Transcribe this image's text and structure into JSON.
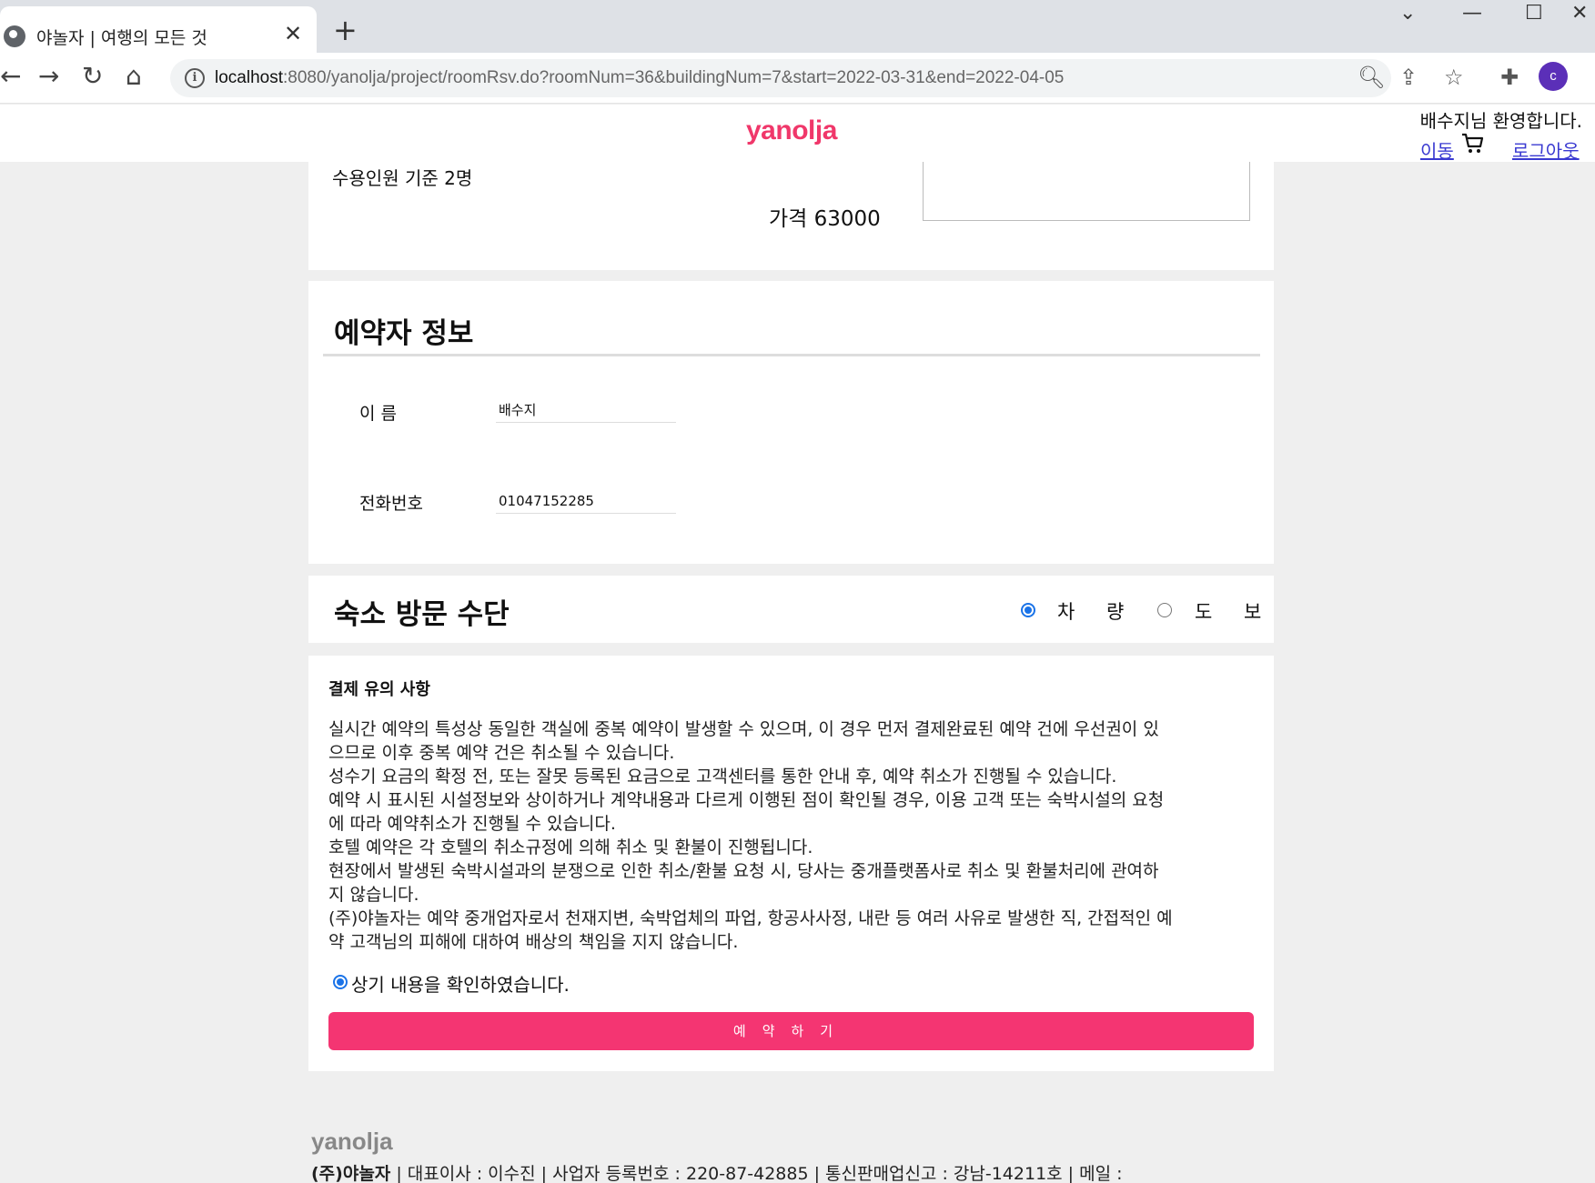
{
  "browser": {
    "tab_title": "야놀자 | 여행의 모든 것",
    "url_host": "localhost",
    "url_rest": ":8080/yanolja/project/roomRsv.do?roomNum=36&buildingNum=7&start=2022-03-31&end=2022-04-05",
    "profile_initial": "c"
  },
  "header": {
    "logo": "yanolja",
    "welcome": "배수지님 환영합니다.",
    "move_link": "이동",
    "logout_link": "로그아웃"
  },
  "room": {
    "capacity": "수용인원 기준 2명",
    "price": "가격 63000"
  },
  "booker": {
    "title": "예약자 정보",
    "name_label": "이 름",
    "name_value": "배수지",
    "phone_label": "전화번호",
    "phone_value": "01047152285"
  },
  "visit": {
    "title": "숙소 방문 수단",
    "option_car": "차 량",
    "option_walk": "도 보",
    "selected": "car"
  },
  "payment": {
    "title": "결제 유의 사항",
    "lines": [
      "실시간 예약의 특성상 동일한 객실에 중복 예약이 발생할 수 있으며, 이 경우 먼저 결제완료된 예약 건에 우선권이 있",
      "으므로 이후 중복 예약 건은 취소될 수 있습니다.",
      "성수기 요금의 확정 전, 또는 잘못 등록된 요금으로 고객센터를 통한 안내 후, 예약 취소가 진행될 수 있습니다.",
      "예약 시 표시된 시설정보와 상이하거나 계약내용과 다르게 이행된 점이 확인될 경우, 이용 고객 또는 숙박시설의 요청",
      "에 따라 예약취소가 진행될 수 있습니다.",
      "호텔 예약은 각 호텔의 취소규정에 의해 취소 및 환불이 진행됩니다.",
      "현장에서 발생된 숙박시설과의 분쟁으로 인한 취소/환불 요청 시, 당사는 중개플랫폼사로 취소 및 환불처리에 관여하",
      "지 않습니다.",
      "(주)야놀자는 예약 중개업자로서 천재지변, 숙박업체의 파업, 항공사사정, 내란 등 여러 사유로 발생한 직, 간접적인 예",
      "약 고객님의 피해에 대하여 배상의 책임을 지지 않습니다."
    ],
    "confirm_label": "상기 내용을 확인하였습니다.",
    "confirm_checked": true,
    "reserve_button": "예약하기"
  },
  "footer": {
    "logo": "yanolja",
    "company": "(주)야놀자",
    "info": " | 대표이사 : 이수진 | 사업자 등록번호 : 220-87-42885 | 통신판매업신고 : 강남-14211호 | 메일 :"
  },
  "colors": {
    "brand": "#f0376a",
    "button": "#f43572",
    "radio_selected": "#1a73e8",
    "link": "#3a3ad1"
  }
}
